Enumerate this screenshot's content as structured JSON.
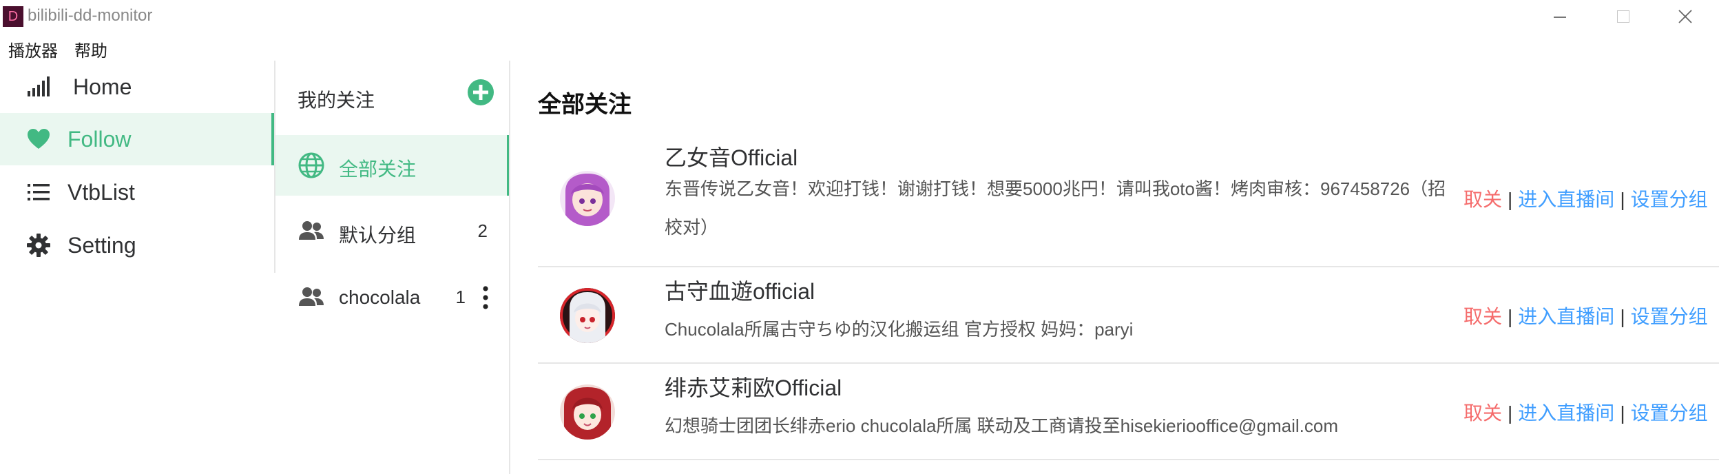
{
  "window": {
    "app_icon": "D",
    "title": "bilibili-dd-monitor"
  },
  "menubar": {
    "items": [
      "播放器",
      "帮助"
    ]
  },
  "nav": {
    "items": [
      {
        "label": "Home",
        "icon": "signal-bars-icon"
      },
      {
        "label": "Follow",
        "icon": "heart-icon",
        "active": true
      },
      {
        "label": "VtbList",
        "icon": "list-icon"
      },
      {
        "label": "Setting",
        "icon": "gear-icon"
      }
    ]
  },
  "groups": {
    "header": "我的关注",
    "items": [
      {
        "label": "全部关注",
        "count": "",
        "icon": "globe-icon",
        "active": true
      },
      {
        "label": "默认分组",
        "count": "2",
        "icon": "users-icon"
      },
      {
        "label": "chocolala",
        "count": "1",
        "icon": "users-icon"
      }
    ]
  },
  "main": {
    "title": "全部关注",
    "actions": {
      "unfollow": "取关",
      "enter_room": "进入直播间",
      "set_group": "设置分组",
      "separator": "|"
    },
    "follows": [
      {
        "name": "乙女音Official",
        "desc": "东晋传说乙女音！欢迎打钱！谢谢打钱！想要5000兆円！请叫我oto酱！烤肉审核：967458726（招校对）"
      },
      {
        "name": "古守血遊official",
        "desc": "Chucolala所属古守ちゆ的汉化搬运组 官方授权 妈妈：paryi"
      },
      {
        "name": "绯赤艾莉欧Official",
        "desc": "幻想骑士团团长绯赤erio chucolala所属 联动及工商请投至hisekieriooffice@gmail.com"
      }
    ]
  },
  "colors": {
    "accent": "#42b983",
    "accent_bg": "#eaf7f0",
    "danger": "#f56c6c",
    "link": "#409eff"
  }
}
